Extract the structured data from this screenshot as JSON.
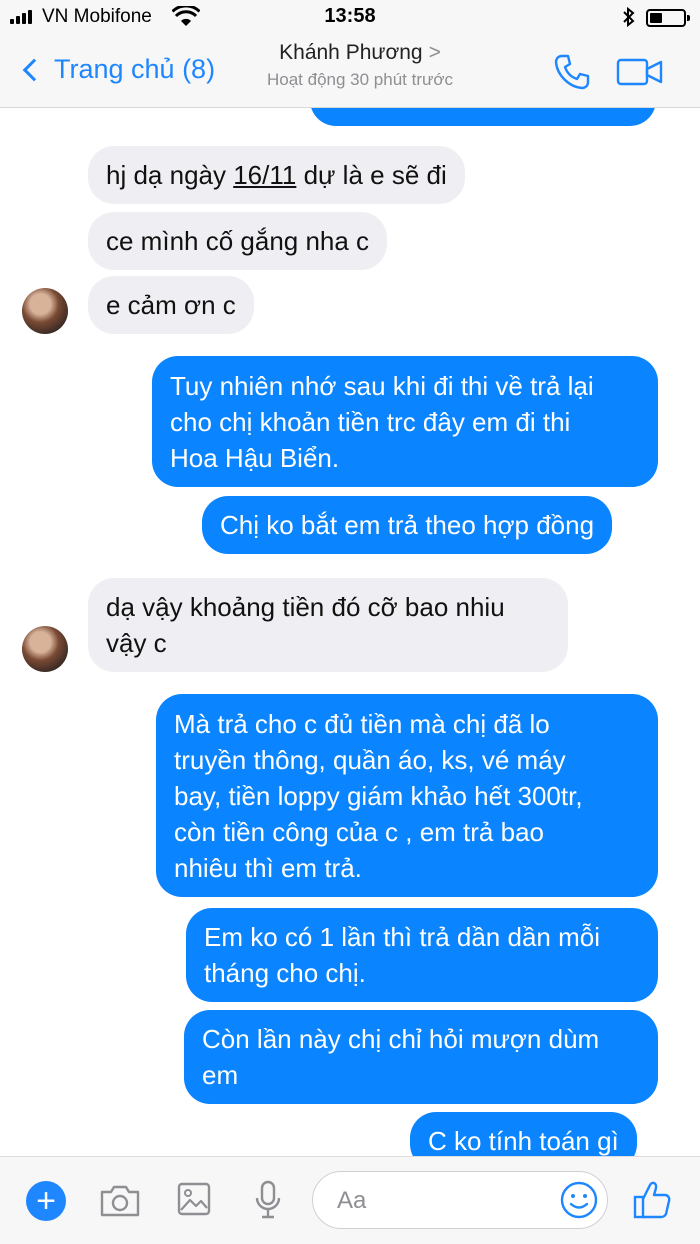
{
  "status_bar": {
    "carrier": "VN Mobifone",
    "time": "13:58",
    "icons": [
      "signal-icon",
      "wifi-icon",
      "bluetooth-icon",
      "battery-icon"
    ]
  },
  "header": {
    "back_label": "Trang chủ (8)",
    "contact_name": "Khánh Phương",
    "contact_chevron": ">",
    "contact_status": "Hoạt động 30 phút trước",
    "icons": [
      "phone-icon",
      "video-call-icon"
    ]
  },
  "messages": [
    {
      "side": "in",
      "parts": [
        "hj dạ ngày ",
        "16/11",
        " dự là e sẽ đi"
      ]
    },
    {
      "side": "in",
      "text": "ce mình cố gắng nha c"
    },
    {
      "side": "in",
      "text": "e cảm ơn c"
    },
    {
      "side": "out",
      "lines": [
        "Tuy nhiên nhớ sau khi đi thi về trả lại",
        "cho chị khoản tiền trc đây em đi thi",
        "Hoa Hậu Biển."
      ]
    },
    {
      "side": "out",
      "text": "Chị ko bắt em trả theo hợp đồng"
    },
    {
      "side": "in",
      "lines": [
        "dạ vậy khoảng tiền đó cỡ bao nhiu",
        "vậy c"
      ]
    },
    {
      "side": "out",
      "lines": [
        "Mà trả cho c đủ tiền mà chị đã lo",
        "truyền thông, quần áo, ks, vé máy",
        "bay, tiền loppy giám khảo hết 300tr,",
        "còn tiền công của c , em trả bao",
        "nhiêu thì em trả."
      ]
    },
    {
      "side": "out",
      "lines": [
        "Em ko có 1 lần thì trả dần dần mỗi",
        "tháng cho chị."
      ]
    },
    {
      "side": "out",
      "lines": [
        "Còn lần này chị chỉ hỏi mượn dùm",
        "em"
      ]
    },
    {
      "side": "out",
      "text": "C ko tính toán gì"
    }
  ],
  "composer": {
    "placeholder": "Aa",
    "icons": [
      "plus-icon",
      "camera-icon",
      "gallery-icon",
      "microphone-icon",
      "emoji-icon",
      "thumbs-up-icon"
    ]
  },
  "colors": {
    "accent": "#1e86ff",
    "outgoing_bubble": "#0a84ff",
    "incoming_bubble": "#efeff3"
  }
}
